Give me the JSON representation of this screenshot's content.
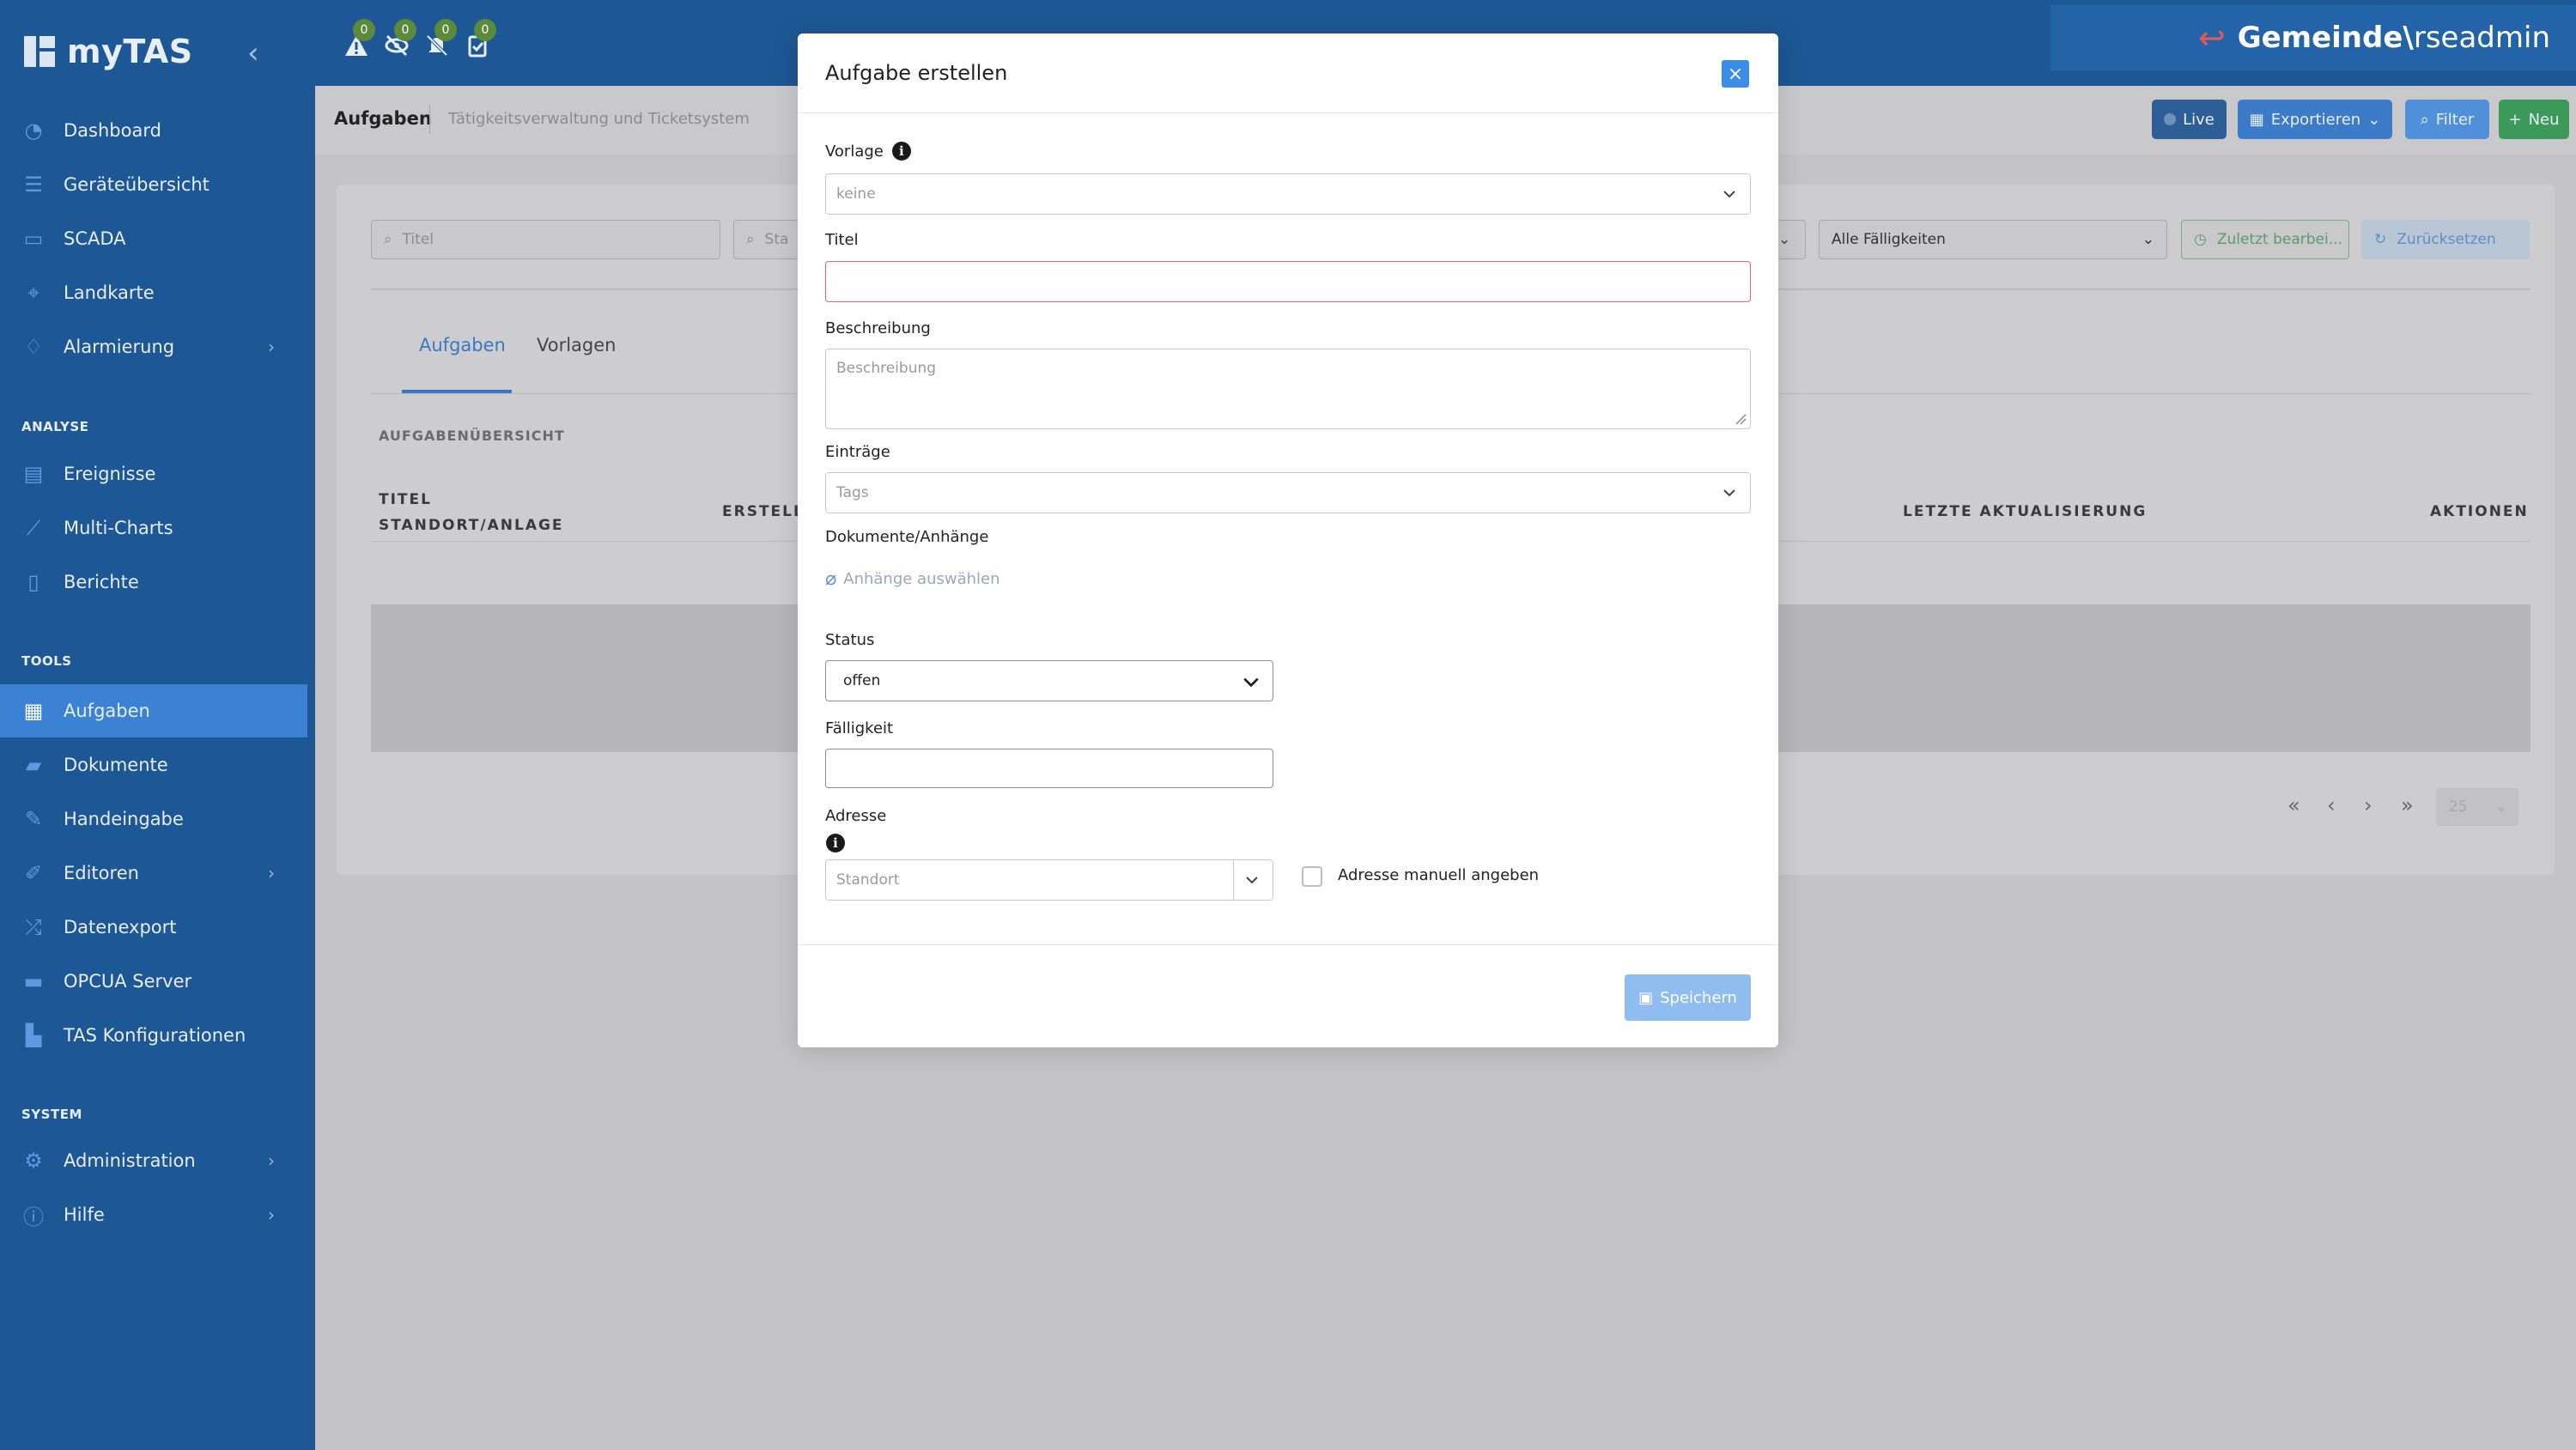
{
  "app": {
    "name": "myTAS"
  },
  "topbar": {
    "badges": [
      "0",
      "0",
      "0",
      "0"
    ],
    "user": {
      "domain": "Gemeinde\\",
      "name": "rseadmin"
    }
  },
  "sidebar": {
    "items_main": [
      {
        "label": "Dashboard",
        "icon": "dashboard-icon"
      },
      {
        "label": "Geräteübersicht",
        "icon": "list-icon"
      },
      {
        "label": "SCADA",
        "icon": "monitor-icon"
      },
      {
        "label": "Landkarte",
        "icon": "map-pin-icon"
      },
      {
        "label": "Alarmierung",
        "icon": "bell-icon",
        "chevron": "›"
      }
    ],
    "section_analyse": "ANALYSE",
    "items_analyse": [
      {
        "label": "Ereignisse",
        "icon": "events-icon"
      },
      {
        "label": "Multi-Charts",
        "icon": "chart-line-icon"
      },
      {
        "label": "Berichte",
        "icon": "report-icon"
      }
    ],
    "section_tools": "TOOLS",
    "items_tools": [
      {
        "label": "Aufgaben",
        "icon": "calendar-check-icon",
        "active": true
      },
      {
        "label": "Dokumente",
        "icon": "folder-open-icon"
      },
      {
        "label": "Handeingabe",
        "icon": "pencil-icon"
      },
      {
        "label": "Editoren",
        "icon": "edit-icon",
        "chevron": "›"
      },
      {
        "label": "Datenexport",
        "icon": "shuffle-icon"
      },
      {
        "label": "OPCUA Server",
        "icon": "server-icon"
      },
      {
        "label": "TAS Konfigurationen",
        "icon": "file-config-icon"
      }
    ],
    "section_system": "SYSTEM",
    "items_system": [
      {
        "label": "Administration",
        "icon": "gears-icon",
        "chevron": "›"
      },
      {
        "label": "Hilfe",
        "icon": "info-circle-icon",
        "chevron": "›"
      }
    ]
  },
  "subheader": {
    "title": "Aufgaben",
    "subtitle": "Tätigkeitsverwaltung und Ticketsystem",
    "buttons": {
      "live": "Live",
      "export": "Exportieren",
      "filter": "Filter",
      "new": "Neu"
    }
  },
  "filters": {
    "title_placeholder": "Titel",
    "status_placeholder": "Sta",
    "due": "Alle Fälligkeiten",
    "recent": "Zuletzt bearbei...",
    "reset": "Zurücksetzen"
  },
  "tabs": [
    "Aufgaben",
    "Vorlagen"
  ],
  "overview": {
    "heading": "AUFGABENÜBERSICHT",
    "columns": {
      "title": "TITEL",
      "location": "STANDORT/ANLAGE",
      "created": "ERSTELLT",
      "updated": "LETZTE AKTUALISIERUNG",
      "actions": "AKTIONEN"
    }
  },
  "pagination": {
    "first": "«",
    "prev": "‹",
    "next": "›",
    "last": "»",
    "page_size": "25"
  },
  "modal": {
    "title": "Aufgabe erstellen",
    "close": "×",
    "template_label": "Vorlage",
    "template_value": "keine",
    "title_label": "Titel",
    "title_value": "",
    "description_label": "Beschreibung",
    "description_placeholder": "Beschreibung",
    "entries_label": "Einträge",
    "entries_placeholder": "Tags",
    "attachments_label": "Dokumente/Anhänge",
    "attachments_link": "Anhänge auswählen",
    "status_label": "Status",
    "status_value": "offen",
    "due_label": "Fälligkeit",
    "due_value": "",
    "address_label": "Adresse",
    "address_placeholder": "Standort",
    "manual_address_label": "Adresse manuell angeben",
    "save": "Speichern"
  },
  "colors": {
    "sidebar": "#1d5795",
    "active": "#3b82d4",
    "accent_blue": "#3b8ee8",
    "green": "#2e9e52",
    "error_border": "#e8606c"
  }
}
